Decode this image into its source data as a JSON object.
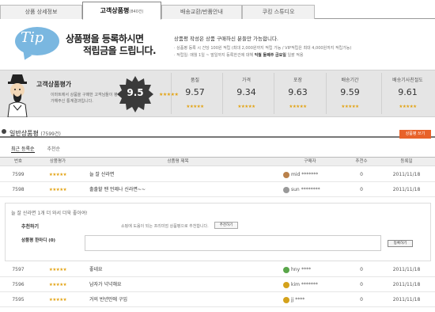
{
  "tabs": [
    {
      "label": "상품 상세정보"
    },
    {
      "label": "고객상품평",
      "count": "(840건)"
    },
    {
      "label": "배송교환/반품안내"
    },
    {
      "label": "쿠킹 스튜디오"
    }
  ],
  "banner": {
    "tip": "Tip",
    "headline_1": "상품평을 등록하시면",
    "headline_2": "적립금을 드립니다.",
    "notice_title": "상품평 작성은 상품 구매하신 분들만 가능합니다.",
    "notice_1": "· 상품평 등록 시 건당 100원 적립 (최대 2,000원까지 적립 가능 / VIP적립은 최대 4,000원까지 적립가능)",
    "notice_2_a": "· 적립일: 매월 1일 ~ 말일까지 등록한건에 대해 ",
    "notice_2_em": "익월 둘째주 금요일",
    "notice_2_b": " 일괄 적용"
  },
  "rating": {
    "title": "고객상품평가",
    "desc": "이마트에서 상품을 구매한 고객님들이 평가해주신 통계결과입니다.",
    "overall": "9.5",
    "overall_stars": "★★★★★",
    "metrics": [
      {
        "label": "품질",
        "value": "9.57",
        "stars": "★★★★★"
      },
      {
        "label": "가격",
        "value": "9.34",
        "stars": "★★★★★"
      },
      {
        "label": "포장",
        "value": "9.63",
        "stars": "★★★★★"
      },
      {
        "label": "배송기간",
        "value": "9.59",
        "stars": "★★★★★"
      },
      {
        "label": "배송기사친절도",
        "value": "9.61",
        "stars": "★★★★★"
      }
    ]
  },
  "section": {
    "title": "일반상품평",
    "count": "(7599건)",
    "write_button": "상품평 쓰기",
    "sort_recent": "최근 등록순",
    "sort_recommend": "추천순"
  },
  "table": {
    "headers": [
      "번호",
      "상품평가",
      "상품평 제목",
      "구매자",
      "추천수",
      "등록일"
    ],
    "rows_top": [
      {
        "no": "7599",
        "stars": "★★★★★",
        "title": "늘 잘 산라면",
        "buyer": "mid *******",
        "grade_color": "#b9814b",
        "rec": "0",
        "date": "2011/11/18"
      },
      {
        "no": "7598",
        "stars": "★★★★★",
        "title": "출출할 땐 언제나 신라면~~",
        "buyer": "sun ********",
        "grade_color": "#999999",
        "rec": "0",
        "date": "2011/11/18"
      }
    ],
    "rows_bottom": [
      {
        "no": "7597",
        "stars": "★★★★★",
        "title": "좋네요",
        "buyer": "hny ****",
        "grade_color": "#5aa64a",
        "rec": "0",
        "date": "2011/11/18"
      },
      {
        "no": "7596",
        "stars": "★★★★★",
        "title": "남자가 넉넉해요",
        "buyer": "kim *******",
        "grade_color": "#d4a21c",
        "rec": "0",
        "date": "2011/11/18"
      },
      {
        "no": "7595",
        "stars": "★★★★★",
        "title": "거의 반년만에 구입",
        "buyer": "jj ****",
        "grade_color": "#d4a21c",
        "rec": "0",
        "date": "2011/11/18"
      }
    ]
  },
  "detail": {
    "text": "늘 잘 산라면 1개 더 와서 더욱 좋아여!",
    "rec_label": "추천하기",
    "rec_text": "쇼핑에 도움이 되는 프리미엄 상품평으로 추천합니다.",
    "rec_button": "추천하기",
    "comment_label": "상품평 한마디 (0)",
    "comment_button": "등록하기"
  }
}
